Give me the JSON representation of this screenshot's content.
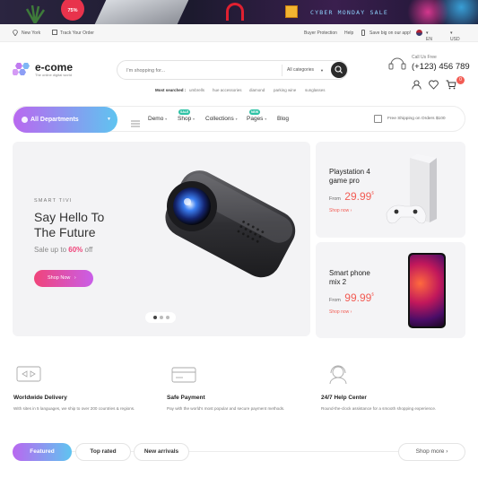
{
  "banner": {
    "sale_badge": "75%",
    "promo_text": "CYBER MONDAY SALE"
  },
  "topbar": {
    "location": "New York",
    "track_order": "Track Your Order",
    "buyer_protection": "Buyer Protection",
    "help": "Help",
    "app_promo": "Save big on our app!",
    "language": "EN",
    "currency": "USD"
  },
  "header": {
    "logo_name": "e-come",
    "logo_tagline": "The online digital world",
    "search_placeholder": "I'm shopping for...",
    "category_select": "All categories",
    "call_label": "Call Us Free",
    "phone": "(+123) 456 789",
    "cart_count": "0",
    "most_searched_label": "Most searched :",
    "most_searched": [
      "umbrells",
      "hue accessories",
      "diamond",
      "parking wine",
      "sunglasses"
    ]
  },
  "nav": {
    "departments": "All Departments",
    "links": [
      "Demo",
      "Shop",
      "Collections",
      "Pages",
      "Blog"
    ],
    "shop_badge": "SALE",
    "pages_badge": "NEW",
    "shipping": "Free Shipping on Orders $100"
  },
  "hero": {
    "eyebrow": "SMART TIVI",
    "title_line1": "Say Hello To",
    "title_line2": "The Future",
    "sale_prefix": "Sale up to",
    "sale_value": "60%",
    "sale_suffix": "off",
    "cta": "Shop Now",
    "slides": 3,
    "active_slide": 1
  },
  "promo_cards": [
    {
      "title_line1": "Playstation 4",
      "title_line2": "game pro",
      "from": "From",
      "price": "29.99",
      "currency": "$",
      "link": "Shop now"
    },
    {
      "title_line1": "Smart phone",
      "title_line2": "mix 2",
      "from": "From",
      "price": "99.99",
      "currency": "$",
      "link": "Shop now"
    }
  ],
  "features": [
    {
      "icon": "delivery-truck-icon",
      "title": "Worldwide Delivery",
      "desc": "With sites in 5 languages, we ship to over 200 countries & regions."
    },
    {
      "icon": "credit-card-icon",
      "title": "Safe Payment",
      "desc": "Pay with the world's most popular and secure payment methods."
    },
    {
      "icon": "headset-icon",
      "title": "24/7 Help Center",
      "desc": "Round-the-clock assistance for a smooth shopping experience."
    }
  ],
  "tabs": [
    "Featured",
    "Top rated",
    "New arrivals"
  ],
  "shop_more": "Shop more",
  "colors": {
    "accent_pink": "#f0447a",
    "gradient_start": "#b968f0",
    "gradient_end": "#5fc4f0",
    "price_red": "#f25c54"
  }
}
